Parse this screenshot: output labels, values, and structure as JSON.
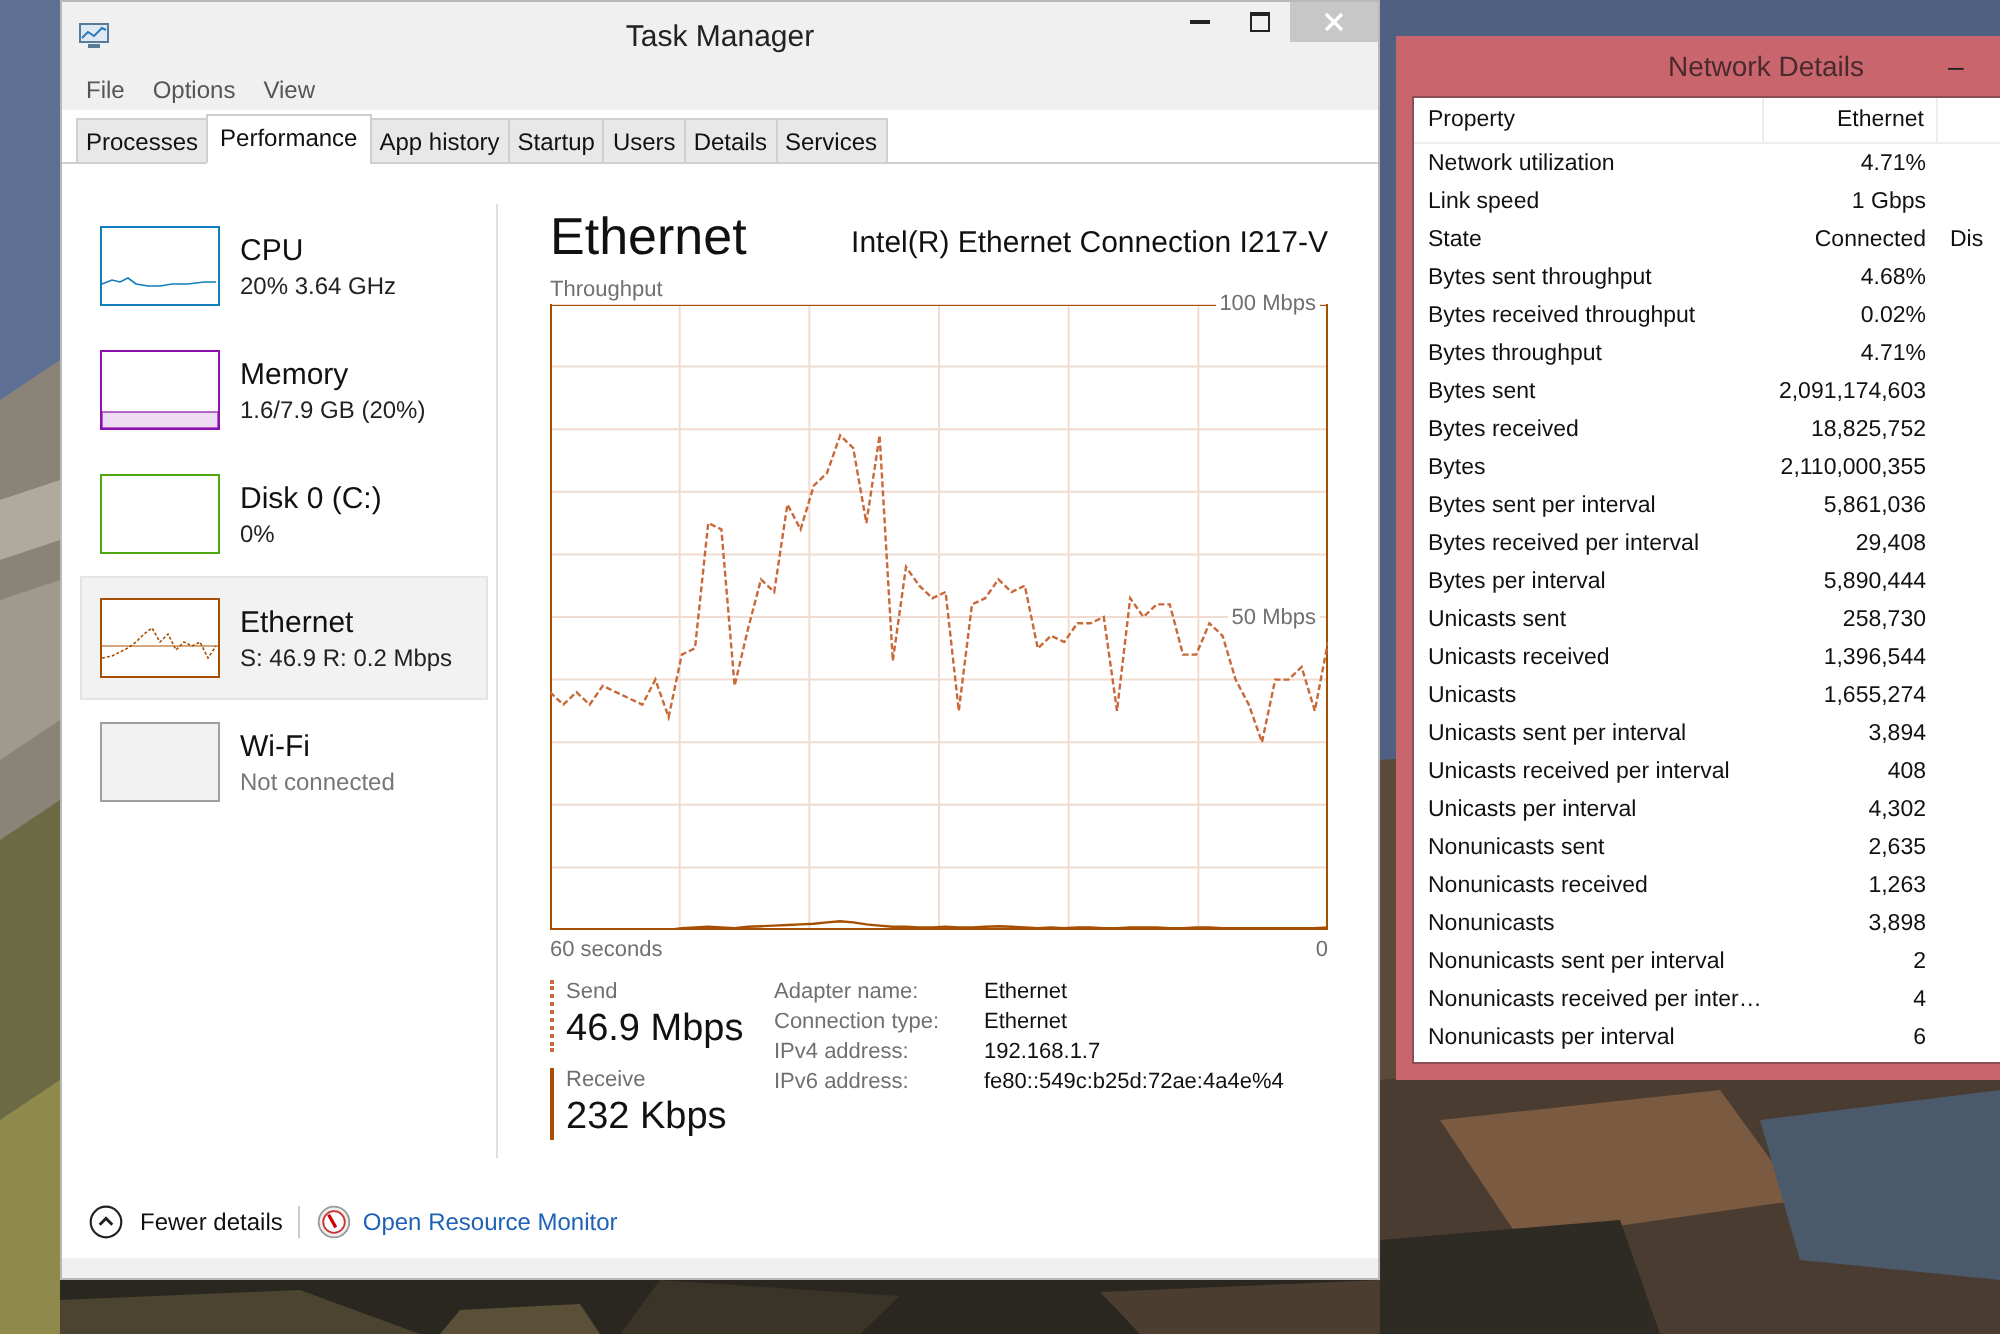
{
  "task_manager": {
    "title": "Task Manager",
    "menu": [
      "File",
      "Options",
      "View"
    ],
    "tabs": [
      {
        "label": "Processes",
        "selected": false
      },
      {
        "label": "Performance",
        "selected": true
      },
      {
        "label": "App history",
        "selected": false
      },
      {
        "label": "Startup",
        "selected": false
      },
      {
        "label": "Users",
        "selected": false
      },
      {
        "label": "Details",
        "selected": false
      },
      {
        "label": "Services",
        "selected": false
      }
    ],
    "sidebar": {
      "items": [
        {
          "name": "CPU",
          "detail": "20% 3.64 GHz",
          "kind": "cpu",
          "color": "#117dbb",
          "connected": true,
          "selected": false
        },
        {
          "name": "Memory",
          "detail": "1.6/7.9 GB (20%)",
          "kind": "memory",
          "color": "#8b12ae",
          "connected": true,
          "selected": false
        },
        {
          "name": "Disk 0 (C:)",
          "detail": "0%",
          "kind": "disk",
          "color": "#4da60c",
          "connected": true,
          "selected": false
        },
        {
          "name": "Ethernet",
          "detail": "S: 46.9 R: 0.2 Mbps",
          "kind": "ethernet",
          "color": "#a74f01",
          "connected": true,
          "selected": true
        },
        {
          "name": "Wi-Fi",
          "detail": "Not connected",
          "kind": "wifi",
          "color": "#a0a0a0",
          "connected": false,
          "selected": false
        }
      ]
    },
    "detail": {
      "title": "Ethernet",
      "adapter": "Intel(R) Ethernet Connection I217-V",
      "chart_data": {
        "type": "line",
        "title": "Throughput",
        "grid": true,
        "ylim": [
          0,
          100
        ],
        "yticks": [
          {
            "value": 100,
            "label": "100 Mbps"
          },
          {
            "value": 50,
            "label": "50 Mbps"
          }
        ],
        "series": [
          {
            "name": "Send",
            "color": "#c8693a",
            "line_style": "dashed",
            "values": [
              38,
              36,
              38,
              36,
              39,
              38,
              37,
              36,
              40,
              34,
              44,
              45,
              65,
              64,
              39,
              48,
              56,
              54,
              68,
              64,
              71,
              73,
              79,
              77,
              65,
              79,
              43,
              58,
              55,
              53,
              54,
              35,
              52,
              53,
              56,
              54,
              55,
              45,
              47,
              46,
              49,
              49,
              50,
              35,
              53,
              50,
              52,
              52,
              44,
              44,
              49,
              47,
              40,
              36,
              30,
              40,
              40,
              42,
              35,
              46
            ]
          },
          {
            "name": "Receive",
            "color": "#a74f01",
            "line_style": "solid",
            "values": [
              0,
              0,
              0,
              0,
              0,
              0,
              0,
              0,
              0,
              0,
              0.3,
              0.4,
              0.5,
              0.4,
              0.3,
              0.5,
              0.6,
              0.7,
              0.8,
              0.9,
              1,
              1.2,
              1.4,
              1.2,
              0.9,
              0.7,
              0.5,
              0.5,
              0.4,
              0.4,
              0.5,
              0.4,
              0.4,
              0.5,
              0.6,
              0.5,
              0.4,
              0.3,
              0.4,
              0.3,
              0.4,
              0.4,
              0.3,
              0.3,
              0.4,
              0.4,
              0.4,
              0.3,
              0.3,
              0.4,
              0.4,
              0.3,
              0.3,
              0.3,
              0.3,
              0.3,
              0.3,
              0.3,
              0.3,
              0.4
            ]
          }
        ]
      },
      "time_span": "60 seconds",
      "time_end": "0",
      "stats": [
        "46.9 Mbps",
        "232 Kbps"
      ],
      "properties": [
        {
          "label": "Adapter name:",
          "value": "Ethernet"
        },
        {
          "label": "Connection type:",
          "value": "Ethernet"
        },
        {
          "label": "IPv4 address:",
          "value": "192.168.1.7"
        },
        {
          "label": "IPv6 address:",
          "value": "fe80::549c:b25d:72ae:4a4e%4"
        }
      ]
    },
    "footer": {
      "fewer_details": "Fewer details",
      "resource_monitor": "Open Resource Monitor"
    }
  },
  "network_details": {
    "title": "Network Details",
    "minimize": "–",
    "columns": [
      "Property",
      "Ethernet"
    ],
    "rows": [
      {
        "property": "Network utilization",
        "ethernet": "4.71%"
      },
      {
        "property": "Link speed",
        "ethernet": "1 Gbps"
      },
      {
        "property": "State",
        "ethernet": "Connected",
        "column_3": "Dis"
      },
      {
        "property": "Bytes sent throughput",
        "ethernet": "4.68%"
      },
      {
        "property": "Bytes received throughput",
        "ethernet": "0.02%"
      },
      {
        "property": "Bytes throughput",
        "ethernet": "4.71%"
      },
      {
        "property": "Bytes sent",
        "ethernet": "2,091,174,603"
      },
      {
        "property": "Bytes received",
        "ethernet": "18,825,752"
      },
      {
        "property": "Bytes",
        "ethernet": "2,110,000,355"
      },
      {
        "property": "Bytes sent per interval",
        "ethernet": "5,861,036"
      },
      {
        "property": "Bytes received per interval",
        "ethernet": "29,408"
      },
      {
        "property": "Bytes per interval",
        "ethernet": "5,890,444"
      },
      {
        "property": "Unicasts sent",
        "ethernet": "258,730"
      },
      {
        "property": "Unicasts received",
        "ethernet": "1,396,544"
      },
      {
        "property": "Unicasts",
        "ethernet": "1,655,274"
      },
      {
        "property": "Unicasts sent per interval",
        "ethernet": "3,894"
      },
      {
        "property": "Unicasts received per interval",
        "ethernet": "408"
      },
      {
        "property": "Unicasts per interval",
        "ethernet": "4,302"
      },
      {
        "property": "Nonunicasts sent",
        "ethernet": "2,635"
      },
      {
        "property": "Nonunicasts received",
        "ethernet": "1,263"
      },
      {
        "property": "Nonunicasts",
        "ethernet": "3,898"
      },
      {
        "property": "Nonunicasts sent per interval",
        "ethernet": "2"
      },
      {
        "property": "Nonunicasts received per inter…",
        "ethernet": "4"
      },
      {
        "property": "Nonunicasts per interval",
        "ethernet": "6"
      }
    ]
  }
}
